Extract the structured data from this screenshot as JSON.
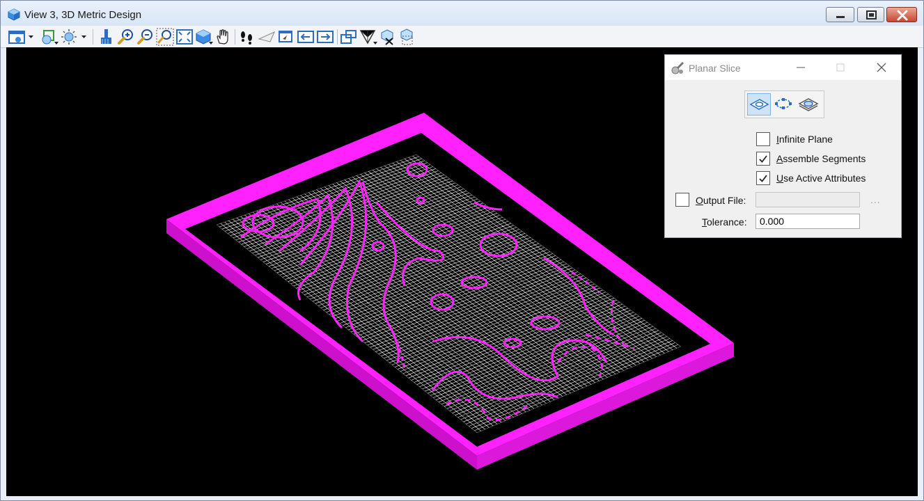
{
  "window": {
    "title": "View 3, 3D Metric Design",
    "controls": [
      "minimize",
      "maximize",
      "close"
    ]
  },
  "toolbar": {
    "tools": [
      "view-attributes-icon",
      "display-style-icon",
      "lights-icon",
      "clear-icon",
      "zoom-in-icon",
      "zoom-out-icon",
      "window-area-icon",
      "fit-view-icon",
      "rotate-view-icon",
      "pan-view-icon",
      "walk-icon",
      "view-previous-next-icon",
      "copy-view-icon",
      "previous-view-icon",
      "next-view-icon",
      "clip-volume-icon",
      "clip-mask-icon",
      "change-view-perspective-icon",
      "view-rotation-icon"
    ]
  },
  "colors": {
    "viewport_bg": "#000000",
    "contour": "#ff22ff",
    "mesh": "#ffffff"
  },
  "dialog": {
    "title": "Planar Slice",
    "modes": [
      "slice-plane-icon",
      "slice-by-points-icon",
      "slice-by-element-icon"
    ],
    "active_mode": 0,
    "infinite_plane": {
      "label": "Infinite Plane",
      "checked": false
    },
    "assemble_segments": {
      "label": "Assemble Segments",
      "checked": true
    },
    "use_active_attributes": {
      "label": "Use Active Attributes",
      "checked": true
    },
    "output_file": {
      "label": "Output File:",
      "checked": false,
      "value": ""
    },
    "browse_label": "...",
    "tolerance": {
      "label": "Tolerance:",
      "value": "0.000"
    }
  }
}
